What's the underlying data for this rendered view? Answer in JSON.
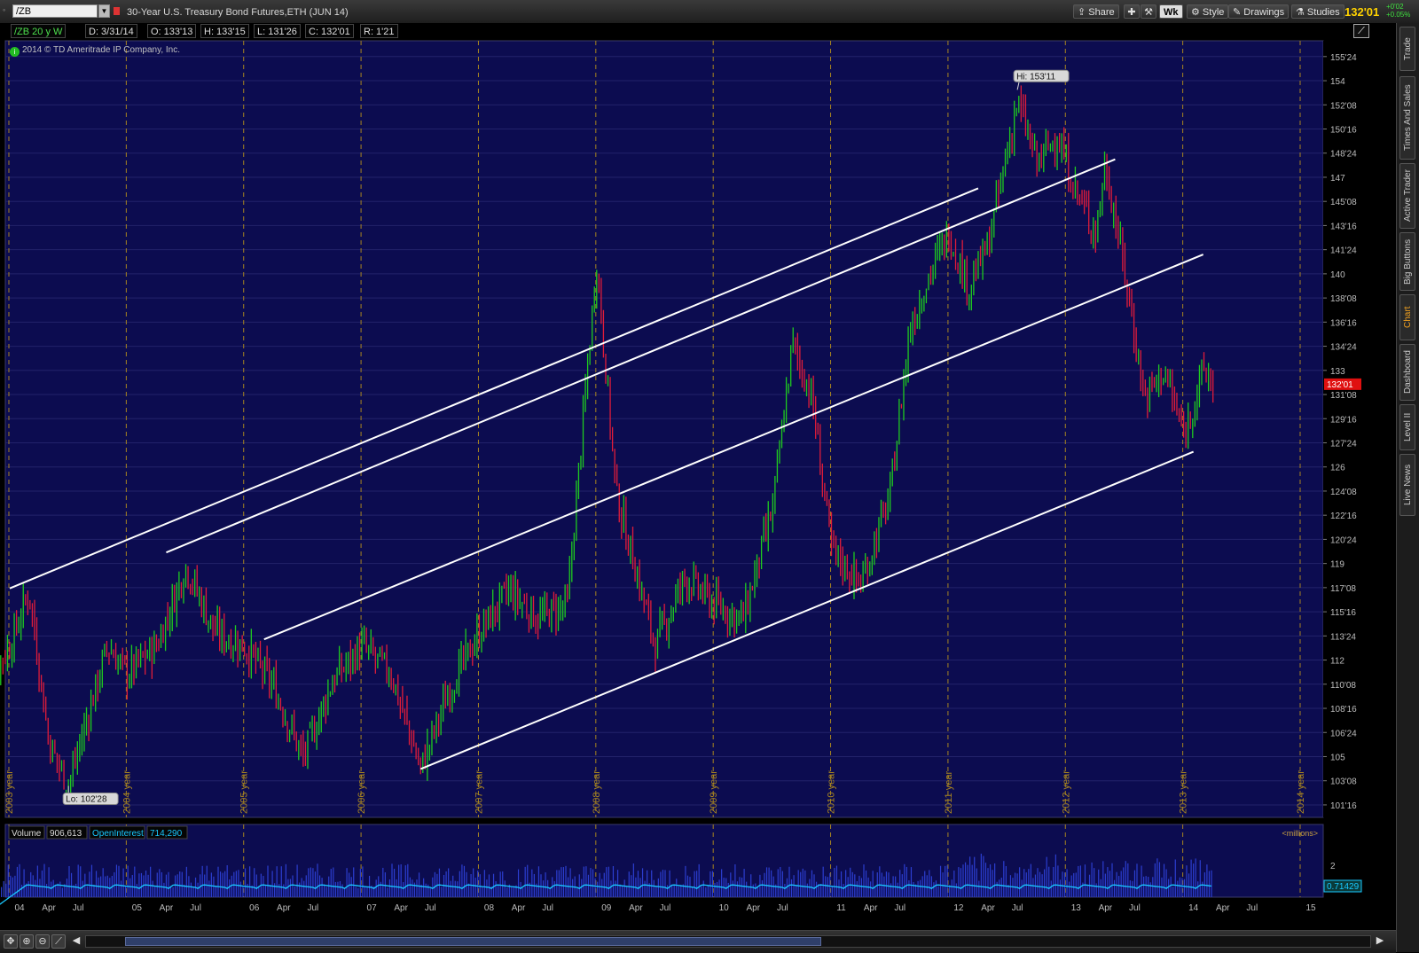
{
  "toolbar": {
    "symbol": "/ZB",
    "title": "30-Year U.S. Treasury Bond Futures,ETH (JUN 14)",
    "buttons": {
      "share": "Share",
      "wk": "Wk",
      "style": "Style",
      "drawings": "Drawings",
      "studies": "Studies"
    },
    "last_price": "132'01",
    "change_1": "+0'02",
    "change_2": "+0.05%"
  },
  "info_bar": {
    "symbol_period": "/ZB 20 y W",
    "date": "D: 3/31/14",
    "open": "O: 133'13",
    "high": "H: 133'15",
    "low": "L: 131'26",
    "close": "C: 132'01",
    "range": "R: 1'21"
  },
  "copyright": "2014 © TD Ameritrade IP Company, Inc.",
  "side_tabs": [
    "Trade",
    "Times And Sales",
    "Active Trader",
    "Big Buttons",
    "Chart",
    "Dashboard",
    "Level II",
    "Live News"
  ],
  "colors": {
    "background": "#0c0c50",
    "up_bar": "#1fcb1f",
    "down_bar": "#e01c3a",
    "trendline": "#ffffff",
    "grid_vertical": "#a88520",
    "price_marker": "#e01010",
    "volume_bar": "#2c3ed0",
    "open_interest_line": "#19c8ff"
  },
  "chart_data": {
    "type": "candlestick",
    "title": "30-Year U.S. Treasury Bond Futures,ETH (JUN 14)",
    "price_axis": {
      "ticks": [
        "155'24",
        "154",
        "152'08",
        "150'16",
        "148'24",
        "147",
        "145'08",
        "143'16",
        "141'24",
        "140",
        "138'08",
        "136'16",
        "134'24",
        "133",
        "131'08",
        "129'16",
        "127'24",
        "126",
        "124'08",
        "122'16",
        "120'24",
        "119",
        "117'08",
        "115'16",
        "113'24",
        "112",
        "110'08",
        "108'16",
        "106'24",
        "105",
        "103'08",
        "101'16"
      ],
      "ylim": [
        100.5,
        156.8
      ]
    },
    "year_labels": [
      "2003 year",
      "2004 year",
      "2005 year",
      "2006 year",
      "2007 year",
      "2008 year",
      "2009 year",
      "2010 year",
      "2011 year",
      "2012 year",
      "2013 year",
      "2014 year"
    ],
    "time_axis": [
      "04",
      "Apr",
      "Jul",
      "05",
      "Apr",
      "Jul",
      "06",
      "Apr",
      "Jul",
      "07",
      "Apr",
      "Jul",
      "08",
      "Apr",
      "Jul",
      "09",
      "Apr",
      "Jul",
      "10",
      "Apr",
      "Jul",
      "11",
      "Apr",
      "Jul",
      "12",
      "Apr",
      "Jul",
      "13",
      "Apr",
      "Jul",
      "14",
      "Apr",
      "Jul",
      "15"
    ],
    "price_path": [
      [
        "2003-09",
        110
      ],
      [
        "2003-12",
        113
      ],
      [
        "2004-02",
        117
      ],
      [
        "2004-04",
        106
      ],
      [
        "2004-06",
        102.9
      ],
      [
        "2004-08",
        108
      ],
      [
        "2004-10",
        113
      ],
      [
        "2004-12",
        111
      ],
      [
        "2005-03",
        113
      ],
      [
        "2005-06",
        118.8
      ],
      [
        "2005-09",
        114
      ],
      [
        "2005-12",
        113
      ],
      [
        "2006-03",
        110
      ],
      [
        "2006-06",
        104.9
      ],
      [
        "2006-09",
        110.5
      ],
      [
        "2006-12",
        113
      ],
      [
        "2007-03",
        111
      ],
      [
        "2007-06",
        104.1
      ],
      [
        "2007-09",
        110
      ],
      [
        "2007-12",
        114
      ],
      [
        "2008-03",
        117
      ],
      [
        "2008-06",
        115
      ],
      [
        "2008-09",
        116
      ],
      [
        "2008-12",
        141
      ],
      [
        "2009-02",
        124
      ],
      [
        "2009-06",
        113
      ],
      [
        "2009-09",
        118
      ],
      [
        "2009-12",
        116
      ],
      [
        "2010-03",
        115
      ],
      [
        "2010-06",
        123
      ],
      [
        "2010-08",
        135
      ],
      [
        "2010-10",
        131
      ],
      [
        "2010-12",
        120
      ],
      [
        "2011-03",
        117.5
      ],
      [
        "2011-06",
        124
      ],
      [
        "2011-08",
        136
      ],
      [
        "2011-10",
        140
      ],
      [
        "2011-12",
        143
      ],
      [
        "2012-02",
        139
      ],
      [
        "2012-04",
        142
      ],
      [
        "2012-07",
        152.5
      ],
      [
        "2012-09",
        148
      ],
      [
        "2012-11",
        150
      ],
      [
        "2013-01",
        146
      ],
      [
        "2013-03",
        143
      ],
      [
        "2013-04",
        148
      ],
      [
        "2013-06",
        140
      ],
      [
        "2013-08",
        131
      ],
      [
        "2013-10",
        133
      ],
      [
        "2013-12",
        128.3
      ],
      [
        "2014-02",
        133
      ],
      [
        "2014-03",
        132
      ]
    ],
    "annotations": [
      {
        "text": "Hi: 153'11",
        "date": "2012-07",
        "value": 153.34
      },
      {
        "text": "Lo: 102'28",
        "date": "2004-06",
        "value": 102.875
      }
    ],
    "last_price_marker": "132'01",
    "trendlines": [
      {
        "from": [
          "2003-12",
          117.2
        ],
        "to": [
          "2012-03",
          146.2
        ]
      },
      {
        "from": [
          "2005-04",
          119.8
        ],
        "to": [
          "2013-05",
          148.3
        ]
      },
      {
        "from": [
          "2006-02",
          113.5
        ],
        "to": [
          "2014-02",
          141.4
        ]
      },
      {
        "from": [
          "2007-06",
          104.1
        ],
        "to": [
          "2014-01",
          127.1
        ]
      }
    ],
    "lower_panel": {
      "volume_label": "Volume",
      "volume_value": "906,613",
      "oi_label": "OpenInterest",
      "oi_value": "714,290",
      "units": "<millions>",
      "ticks": [
        "2"
      ],
      "oi_marker": "0.71429"
    }
  }
}
